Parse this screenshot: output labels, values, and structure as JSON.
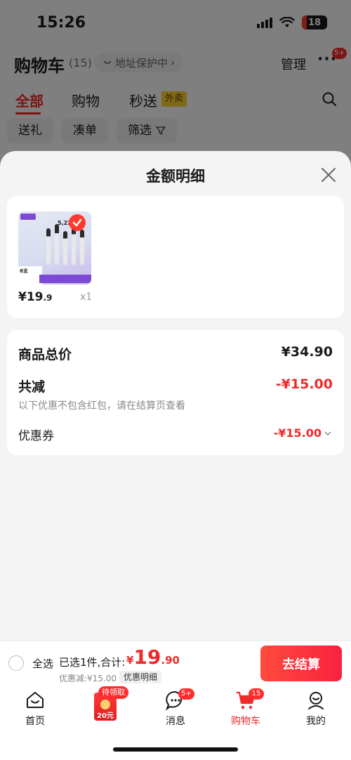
{
  "status_bar": {
    "time": "15:26",
    "battery": "18"
  },
  "cart_header": {
    "title": "购物车",
    "count": "(15)",
    "address_protect": "地址保护中",
    "manage": "管理",
    "more_badge": "5+"
  },
  "tabs": [
    {
      "label": "全部"
    },
    {
      "label": "购物"
    },
    {
      "label": "秒送"
    }
  ],
  "tab_tag": "外卖",
  "filters": [
    {
      "label": "送礼"
    },
    {
      "label": "凑单"
    },
    {
      "label": "筛选"
    }
  ],
  "sheet": {
    "title": "金额明细",
    "item": {
      "thumb_text": "8支",
      "thumb_count": "5,220",
      "price_int": "¥19",
      "price_dec": ".9",
      "qty": "x1"
    },
    "total_label": "商品总价",
    "total_value": "¥34.90",
    "reduce_label": "共减",
    "reduce_value": "-¥15.00",
    "reduce_note": "以下优惠不包含红包，请在结算页查看",
    "coupon_label": "优惠券",
    "coupon_value": "-¥15.00"
  },
  "checkout": {
    "select_all": "全选",
    "summary": "已选1件,合计:",
    "currency": "¥",
    "total_int": "19",
    "total_dec": ".90",
    "discount": "优惠减:¥15.00",
    "detail": "优惠明细",
    "button": "去结算"
  },
  "tabbar": {
    "home": "首页",
    "redpack_tag": "待领取",
    "redpack_amount": "20元",
    "messages": "消息",
    "messages_badge": "5+",
    "cart": "购物车",
    "cart_badge": "15",
    "mine": "我的"
  },
  "colors": {
    "accent": "#f02a2a",
    "overlay": "rgba(0,0,0,0.5)"
  }
}
